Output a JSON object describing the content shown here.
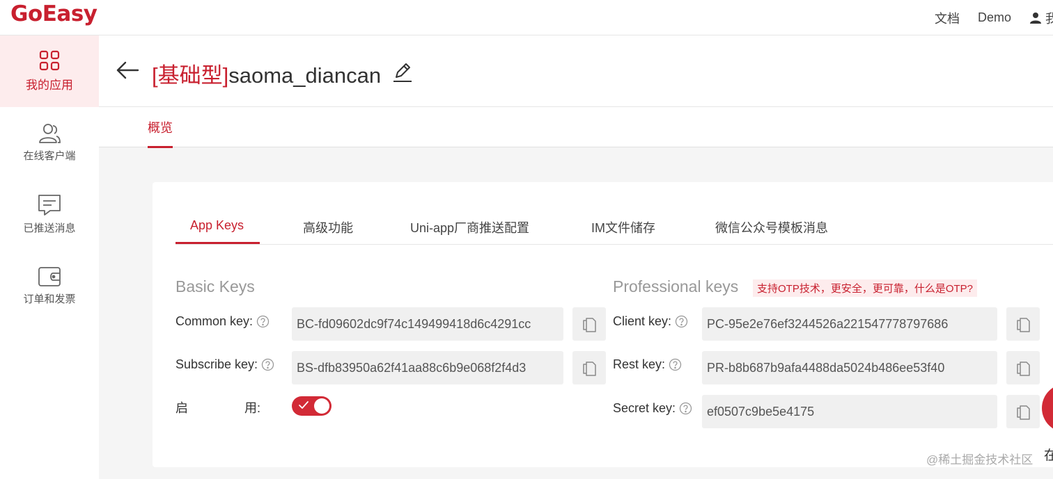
{
  "brand": {
    "logo": "GoEasy",
    "accent": "#c8202f"
  },
  "topnav": {
    "docs": "文档",
    "demo": "Demo",
    "user_label": "我"
  },
  "sidebar": {
    "items": [
      {
        "label": "我的应用",
        "icon": "grid-icon"
      },
      {
        "label": "在线客户端",
        "icon": "users-icon"
      },
      {
        "label": "已推送消息",
        "icon": "message-icon"
      },
      {
        "label": "订单和发票",
        "icon": "wallet-icon"
      }
    ]
  },
  "header": {
    "type_tag": "[基础型]",
    "app_name": "saoma_diancan"
  },
  "subtabs": {
    "overview": "概览"
  },
  "tabs": [
    "App Keys",
    "高级功能",
    "Uni-app厂商推送配置",
    "IM文件储存",
    "微信公众号模板消息"
  ],
  "basic": {
    "title": "Basic Keys",
    "common_label": "Common key:",
    "common_value": "BC-fd09602dc9f74c149499418d6c4291cc",
    "subscribe_label": "Subscribe key:",
    "subscribe_value": "BS-dfb83950a62f41aa88c6b9e068f2f4d3",
    "enable_label_a": "启",
    "enable_label_b": "用:",
    "enabled": true
  },
  "professional": {
    "title": "Professional keys",
    "otp_note": "支持OTP技术，更安全，更可靠，什么是OTP?",
    "client_label": "Client key:",
    "client_value": "PC-95e2e76ef3244526a221547778797686",
    "rest_label": "Rest key:",
    "rest_value": "PR-b8b687b9afa4488da5024b486ee53f40",
    "secret_label": "Secret key:",
    "secret_value": "ef0507c9be5e4175"
  },
  "float_text": "在",
  "watermark": "@稀土掘金技术社区"
}
